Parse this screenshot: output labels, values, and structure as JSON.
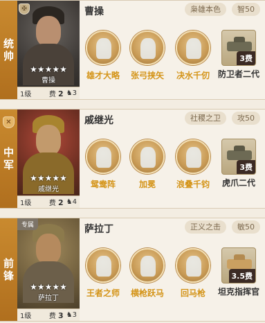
{
  "generals": [
    {
      "role": [
        "统",
        "帅"
      ],
      "role_icon": "shield-icon",
      "corner_tag": "",
      "name": "曹操",
      "portrait_name": "曹操",
      "stars": "★★★★★",
      "level": "1级",
      "cost_label": "费",
      "cost": "2",
      "horse_count": "3",
      "trait": "枭雄本色",
      "stat": "智50",
      "skills": [
        "雄才大略",
        "张弓挟矢",
        "决水千仞"
      ],
      "unit": {
        "name": "防卫者二代",
        "cost": "3费",
        "icon": "tank-icon"
      }
    },
    {
      "role": [
        "中",
        "军"
      ],
      "role_icon": "crossed-swords-icon",
      "corner_tag": "",
      "name": "戚继光",
      "portrait_name": "戚继光",
      "stars": "★★★★★",
      "level": "1级",
      "cost_label": "费",
      "cost": "2",
      "horse_count": "4",
      "trait": "社稷之卫",
      "stat": "攻50",
      "skills": [
        "鸳鸯阵",
        "加冕",
        "浪叠千钧"
      ],
      "unit": {
        "name": "虎爪二代",
        "cost": "3费",
        "icon": "tank-icon"
      }
    },
    {
      "role": [
        "前",
        "锋"
      ],
      "role_icon": "",
      "corner_tag": "专属",
      "name": "萨拉丁",
      "portrait_name": "萨拉丁",
      "stars": "★★★★★",
      "level": "1级",
      "cost_label": "费",
      "cost": "3",
      "horse_count": "3",
      "trait": "正义之击",
      "stat": "敏50",
      "skills": [
        "王者之师",
        "横枪跃马",
        "回马枪"
      ],
      "unit": {
        "name": "坦克指挥官",
        "cost": "3.5费",
        "icon": "tank-icon"
      }
    }
  ]
}
